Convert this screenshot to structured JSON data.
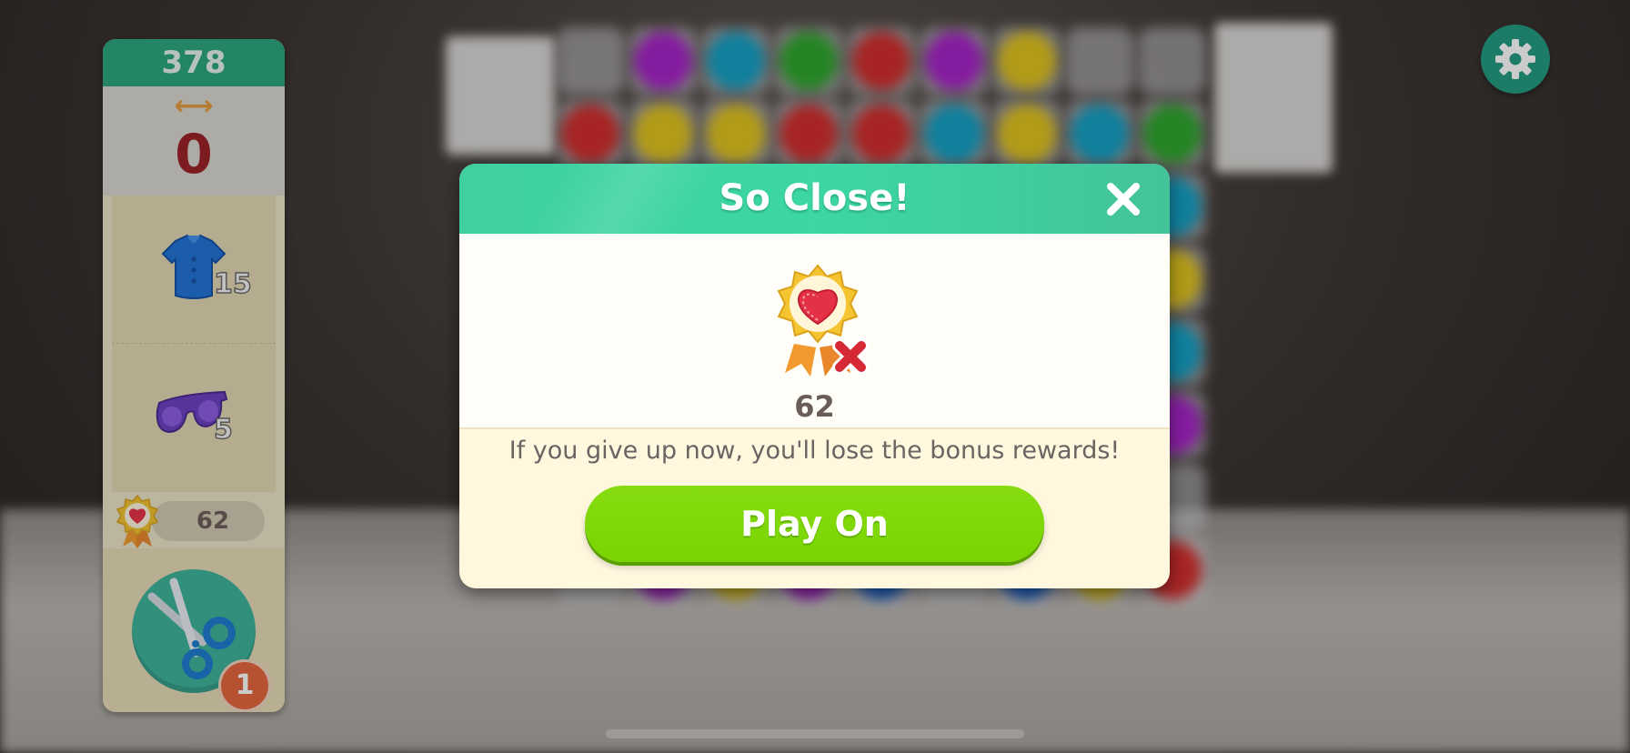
{
  "hud": {
    "score": "378",
    "moves": "0",
    "goals": [
      {
        "item": "shirt-icon",
        "count": "15"
      },
      {
        "item": "sunglasses-icon",
        "count": "5"
      }
    ],
    "medal_count": "62",
    "booster": {
      "icon": "scissors-icon",
      "count": "1"
    }
  },
  "dialog": {
    "title": "So Close!",
    "medal_count": "62",
    "message": "If you give up now, you'll lose the bonus rewards!",
    "play_on_label": "Play On"
  },
  "colors": {
    "header_green": "#3cd7a4",
    "play_button": "#7fd600",
    "score_bar": "#2aa47e",
    "moves_red": "#9a1e24"
  }
}
